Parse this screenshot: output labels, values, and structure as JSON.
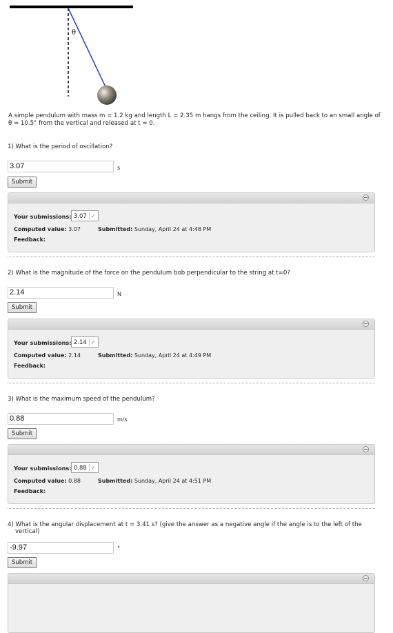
{
  "figure": {
    "angle_label": "θ"
  },
  "problem_text": "A simple pendulum with mass m = 1.2 kg and length L = 2.35 m hangs from the ceiling. It is pulled back to an small angle of θ = 10.5° from the vertical and released at t = 0.",
  "submit_label": "Submit",
  "panel_labels": {
    "your_submissions": "Your submissions:",
    "computed_value": "Computed value:",
    "submitted": "Submitted:",
    "feedback": "Feedback:"
  },
  "check_glyph": "✓",
  "questions": [
    {
      "text": "1) What is the period of oscillation?",
      "answer": "3.07",
      "unit": "s",
      "submission": "3.07",
      "computed": "3.07",
      "submitted": "Sunday, April 24 at 4:48 PM"
    },
    {
      "text": "2) What is the magnitude of the force on the pendulum bob perpendicular to the string at t=0?",
      "answer": "2.14",
      "unit": "N",
      "submission": "2.14",
      "computed": "2.14",
      "submitted": "Sunday, April 24 at 4:49 PM"
    },
    {
      "text": "3) What is the maximum speed of the pendulum?",
      "answer": "0.88",
      "unit": "m/s",
      "submission": "0.88",
      "computed": "0.88",
      "submitted": "Sunday, April 24 at 4:51 PM"
    },
    {
      "text": "4) What is the angular displacement at t = 3.41 s? (give the answer as a negative angle if the angle is to the left of the",
      "text_cont": "vertical)",
      "answer": "-9.97",
      "unit": "°"
    }
  ],
  "colors": {
    "string": "#1f3fd6",
    "ceiling": "#000000",
    "bob": "#8a7f72",
    "check": "#5aa02c"
  },
  "icons": {
    "collapse": "collapse-icon",
    "check": "check-icon"
  }
}
